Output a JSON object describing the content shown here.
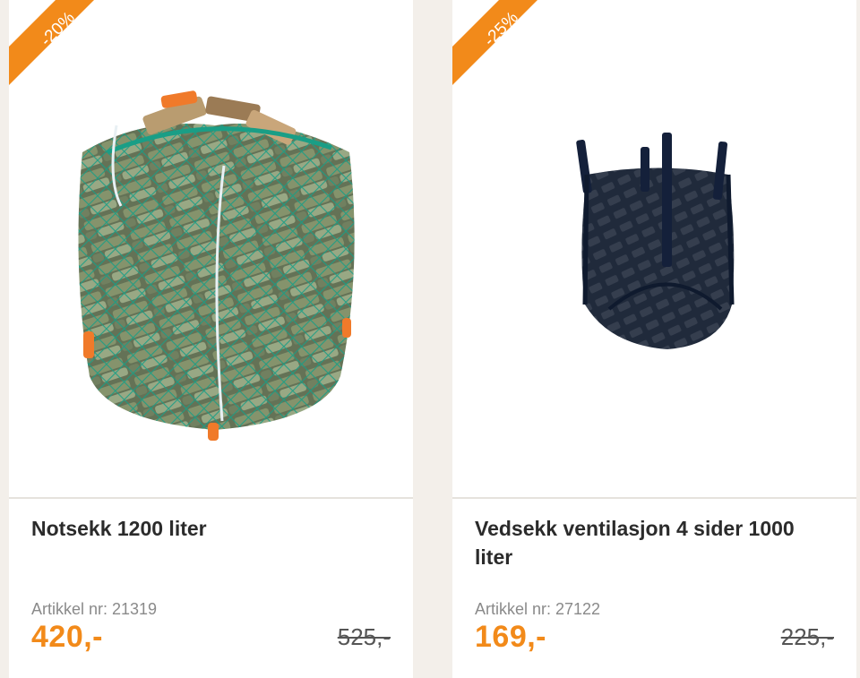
{
  "colors": {
    "accent": "#f28a1a",
    "title": "#2b2b2b",
    "muted": "#8a8a8a",
    "background": "#f3efea"
  },
  "products": [
    {
      "discount": "-20%",
      "image_icon": "firewood-net-bag-image",
      "title": "Notsekk 1200 liter",
      "sku": "Artikkel nr: 21319",
      "price": "420,-",
      "old_price": "525,-"
    },
    {
      "discount": "-25%",
      "image_icon": "firewood-ventilated-bag-image",
      "title": "Vedsekk ventilasjon 4 sider 1000 liter",
      "sku": "Artikkel nr: 27122",
      "price": "169,-",
      "old_price": "225,-"
    }
  ]
}
